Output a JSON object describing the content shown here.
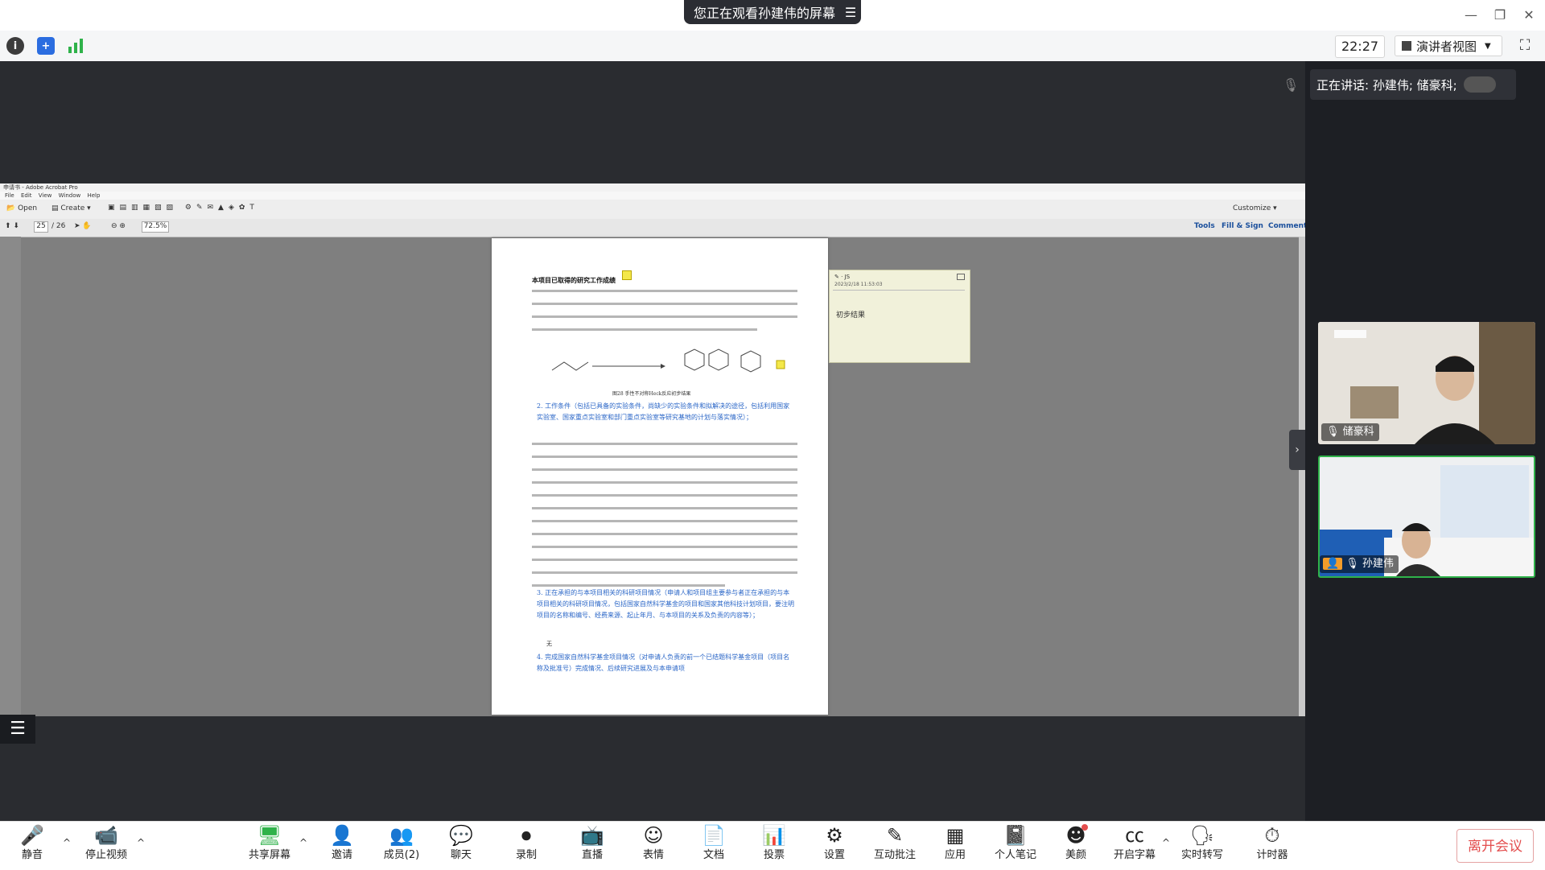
{
  "banner": {
    "text": "您正在观看孙建伟的屏幕"
  },
  "toolbar": {
    "time": "22:27",
    "view_label": "演讲者视图"
  },
  "acrobat": {
    "title": "申请书 - Adobe Acrobat Pro",
    "menu": [
      "File",
      "Edit",
      "View",
      "Window",
      "Help"
    ],
    "open": "Open",
    "create": "Create",
    "customize": "Customize",
    "page_current": "25",
    "page_total": "/ 26",
    "zoom": "72.5%",
    "tools": "Tools",
    "fill_sign": "Fill & Sign",
    "comment": "Comment"
  },
  "document": {
    "heading": "本项目已取得的研究工作成绩",
    "figure_caption": "图28 手性不对称Heck反应初步结果",
    "section2": "2. 工作条件（包括已具备的实验条件，尚缺少的实验条件和拟解决的途径，包括利用国家实验室、国家重点实验室和部门重点实验室等研究基地的计划与落实情况）；",
    "section3": "3. 正在承担的与本项目相关的科研项目情况（申请人和项目组主要参与者正在承担的与本项目相关的科研项目情况，包括国家自然科学基金的项目和国家其他科技计划项目，要注明项目的名称和编号、经费来源、起止年月、与本项目的关系及负责的内容等）；",
    "none": "无",
    "section4": "4. 完成国家自然科学基金项目情况（对申请人负责的前一个已结题科学基金项目（项目名称及批准号）完成情况、后续研究进展及与本申请项"
  },
  "note": {
    "author": "JS",
    "date": "2023/2/18 11:53:03",
    "text": "初步结果"
  },
  "speaking": {
    "text": "正在讲话: 孙建伟; 储豪科;"
  },
  "videos": [
    {
      "name": "储豪科"
    },
    {
      "name": "孙建伟"
    }
  ],
  "bottom": {
    "mute": "静音",
    "stop_video": "停止视频",
    "share": "共享屏幕",
    "invite": "邀请",
    "members": "成员(2)",
    "chat": "聊天",
    "record": "录制",
    "live": "直播",
    "emoji": "表情",
    "docs": "文档",
    "vote": "投票",
    "settings": "设置",
    "annotate": "互动批注",
    "apps": "应用",
    "notes": "个人笔记",
    "beauty": "美颜",
    "captions": "开启字幕",
    "transcribe": "实时转写",
    "timer": "计时器",
    "leave": "离开会议"
  }
}
